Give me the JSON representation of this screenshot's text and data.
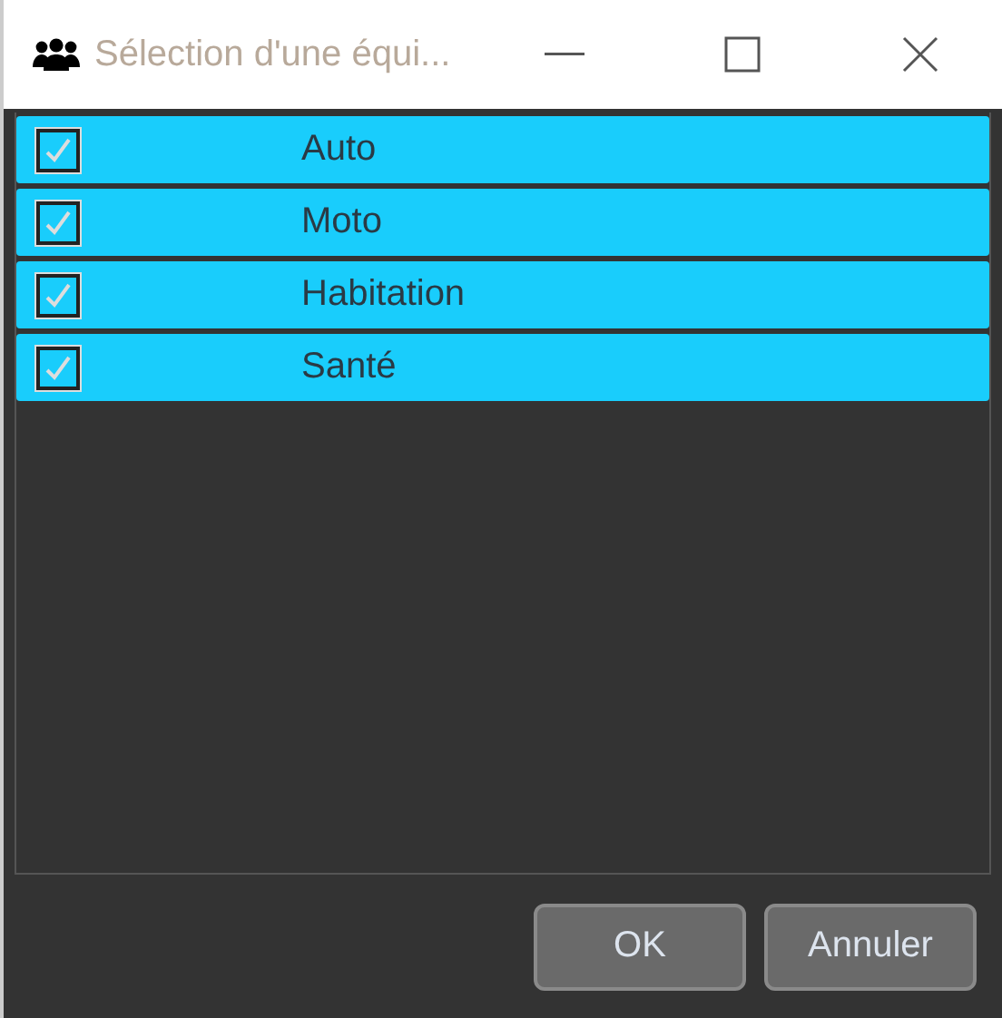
{
  "window": {
    "title": "Sélection d'une équi..."
  },
  "items": [
    {
      "label": "Auto",
      "checked": true,
      "selected": true
    },
    {
      "label": "Moto",
      "checked": true,
      "selected": true
    },
    {
      "label": "Habitation",
      "checked": true,
      "selected": true
    },
    {
      "label": "Santé",
      "checked": true,
      "selected": true
    }
  ],
  "buttons": [
    "OK",
    "Annuler"
  ]
}
